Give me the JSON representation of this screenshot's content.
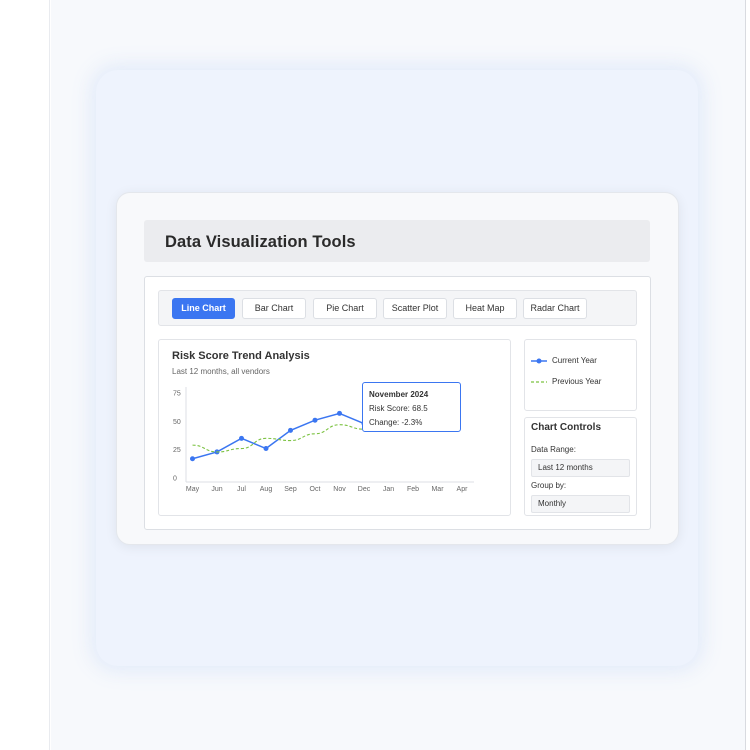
{
  "page": {
    "title": "Data Visualization Tools"
  },
  "tabs": [
    {
      "label": "Line Chart",
      "active": true
    },
    {
      "label": "Bar Chart",
      "active": false
    },
    {
      "label": "Pie Chart",
      "active": false
    },
    {
      "label": "Scatter Plot",
      "active": false
    },
    {
      "label": "Heat Map",
      "active": false
    },
    {
      "label": "Radar Chart",
      "active": false
    }
  ],
  "chart": {
    "title": "Risk Score Trend Analysis",
    "subtitle": "Last 12 months, all vendors"
  },
  "tooltip": {
    "title": "November 2024",
    "line1": "Risk Score: 68.5",
    "line2": "Change: -2.3%"
  },
  "legend": {
    "current": "Current Year",
    "previous": "Previous Year"
  },
  "controls": {
    "title": "Chart Controls",
    "range_label": "Data Range:",
    "range_value": "Last 12 months",
    "group_label": "Group by:",
    "group_value": "Monthly"
  },
  "colors": {
    "accent": "#3b76f1",
    "previous": "#7cc242"
  },
  "chart_data": {
    "type": "line",
    "categories": [
      "May",
      "Jun",
      "Jul",
      "Aug",
      "Sep",
      "Oct",
      "Nov",
      "Dec",
      "Jan",
      "Feb",
      "Mar",
      "Apr"
    ],
    "y_ticks": [
      0,
      25,
      50,
      75
    ],
    "ylim": [
      0,
      75
    ],
    "series": [
      {
        "name": "Current Year",
        "values": [
          17,
          23,
          35,
          26,
          42,
          51,
          57,
          48,
          null,
          null,
          null,
          null
        ]
      },
      {
        "name": "Previous Year",
        "values": [
          29,
          23,
          26,
          35,
          33,
          39,
          47,
          43,
          null,
          null,
          null,
          null
        ]
      }
    ]
  }
}
